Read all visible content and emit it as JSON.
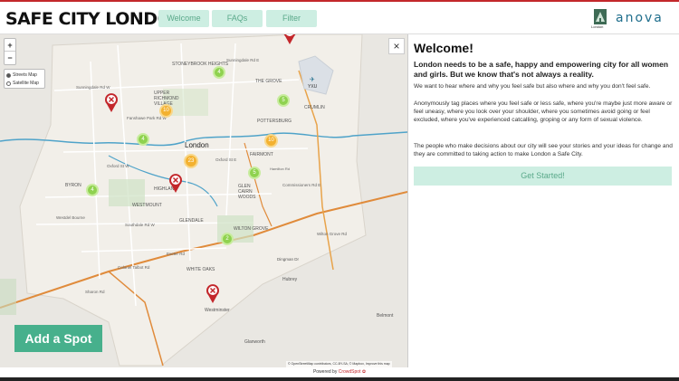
{
  "header": {
    "logo": "SAFE CITY LONDON",
    "nav": [
      "Welcome",
      "FAQs",
      "Filter"
    ],
    "partner_logo_text": "London",
    "partner_brand": "anova"
  },
  "map": {
    "zoom_in": "+",
    "zoom_out": "−",
    "layers": [
      "Streets Map",
      "Satellite Map"
    ],
    "selected_layer": "Streets Map",
    "clusters": [
      "4",
      "10",
      "5",
      "4",
      "10",
      "23",
      "5",
      "4",
      "2"
    ],
    "places": [
      "STONEYBROOK HEIGHTS",
      "UPPER RICHMOND VILLAGE",
      "THE GROVE",
      "POTTERSBURG",
      "FAIRMONT",
      "Hamilton Rd",
      "GLEN CAIRN WOODS",
      "WESTMOUNT",
      "GLENDALE",
      "WHITE OAKS",
      "WILTON GROVE",
      "HIGHLAND",
      "Westminster",
      "London",
      "CRUMLIN",
      "YXU",
      "Dingman Dr",
      "Hubrey",
      "Belmont",
      "Glanworth",
      "Southdale Rd W",
      "Exeter Rd",
      "Wilton Grove Rd",
      "Commissioners Rd E",
      "Oxford St W",
      "Oxford St E",
      "Fanshawe Park Rd W",
      "Sunningdale Rd W",
      "Westdel Bourne",
      "Sharon Rd",
      "Colonel Talbot Rd",
      "Sunningdale Rd E",
      "BYRON"
    ],
    "add_spot": "Add a Spot",
    "attribution": "© OpenStreetMap contributors, CC-BY-SA, © Mapbox, Improve this map"
  },
  "panel": {
    "close": "×",
    "title": "Welcome!",
    "lead": "London needs to be a safe, happy and empowering city for all women and girls. But we know that's not always a reality.",
    "p1": "We want to hear where and why you feel safe but also where and why you don't feel safe.",
    "p2": "Anonymously tag places where you feel safe or less safe, where you're maybe just more aware or feel uneasy, where you look over your shoulder, where you sometimes avoid going or feel excluded, where you've experienced catcalling, groping or any form of sexual violence.",
    "p3": "The people who make decisions about our city will see your stories and your ideas for change and they are committed to taking action to make London a Safe City.",
    "cta": "Get Started!"
  },
  "footer": {
    "powered": "Powered by",
    "brand": "CrowdSpot"
  },
  "colors": {
    "accent": "#47b08c",
    "nav_bg": "#cdeee2",
    "marker_red": "#c3272b",
    "cluster": "#8fd24f",
    "cluster_orange": "#f3b130"
  }
}
